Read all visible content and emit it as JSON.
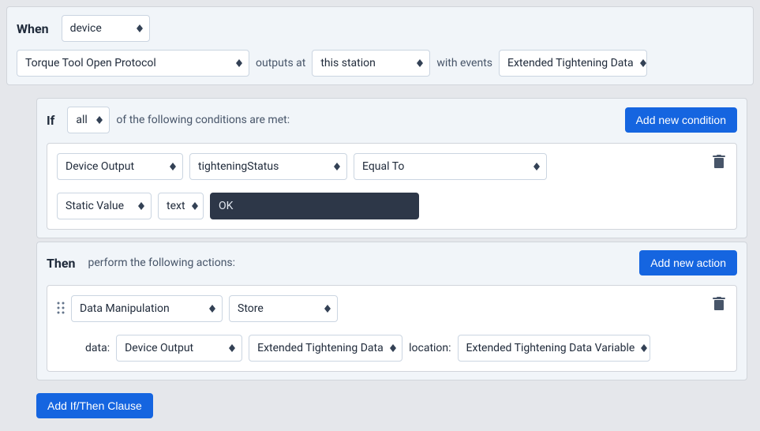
{
  "when": {
    "title": "When",
    "subject": "device",
    "device": "Torque Tool Open Protocol",
    "outputs_at_label": "outputs at",
    "station": "this station",
    "with_events_label": "with events",
    "events": "Extended Tightening Data"
  },
  "if": {
    "title": "If",
    "mode": "all",
    "suffix": "of the following conditions are met:",
    "add_label": "Add new condition",
    "condition": {
      "source": "Device Output",
      "field": "tighteningStatus",
      "operator": "Equal To",
      "value_type": "Static Value",
      "value_format": "text",
      "value": "OK"
    }
  },
  "then": {
    "title": "Then",
    "suffix": "perform the following actions:",
    "add_label": "Add new action",
    "action": {
      "category": "Data Manipulation",
      "operation": "Store",
      "data_label": "data:",
      "data_source": "Device Output",
      "data_field": "Extended Tightening Data",
      "location_label": "location:",
      "location": "Extended Tightening Data Variable"
    }
  },
  "add_clause_label": "Add If/Then Clause"
}
